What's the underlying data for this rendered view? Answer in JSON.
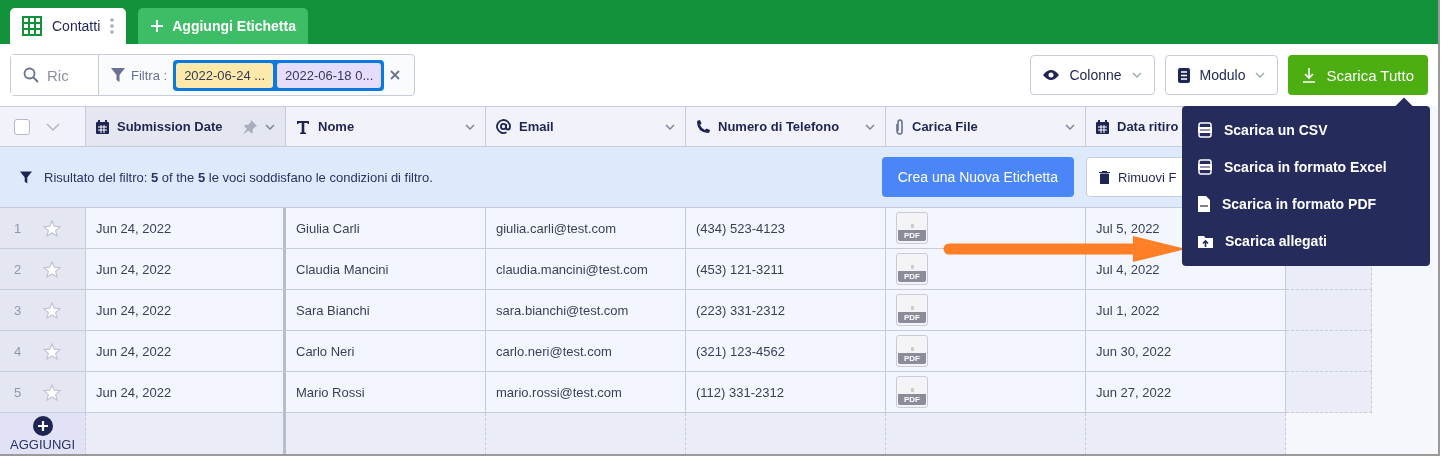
{
  "tabs": [
    {
      "label": "Contatti",
      "selected": true
    }
  ],
  "add_tab_button": "Aggiungi Etichetta",
  "toolbar": {
    "search": {
      "placeholder": "Ric"
    },
    "filter_label": "Filtra :",
    "filter_chips": [
      {
        "label": "2022-06-24 ...",
        "color": "#fde9a9"
      },
      {
        "label": "2022-06-18 0...",
        "color": "#e5ddfb"
      }
    ],
    "columns_button": "Colonne",
    "form_button": "Modulo",
    "download_button": "Scarica Tutto"
  },
  "table": {
    "select_all": {
      "checked": false
    },
    "columns": [
      {
        "label": "Submission Date",
        "kind": "calendar",
        "pinned": true
      },
      {
        "label": "Nome",
        "kind": "text",
        "pinned": false
      },
      {
        "label": "Email",
        "kind": "at",
        "pinned": false
      },
      {
        "label": "Numero di Telefono",
        "kind": "phone",
        "pinned": false
      },
      {
        "label": "Carica File",
        "kind": "clip",
        "pinned": false
      },
      {
        "label": "Data ritiro",
        "kind": "calendar",
        "pinned": false
      }
    ],
    "filter_banner": {
      "text": "Risultato del filtro: **5** of the **5** le voci soddisfano le condizioni di filtro.",
      "create_button": "Crea una Nuova Etichetta",
      "remove_button": "Rimuovi F"
    },
    "rows": [
      {
        "number": "1",
        "starred": false,
        "date": "Jun 24, 2022",
        "name": "Giulia Carli",
        "email": "giulia.carli@test.com",
        "phone": "(434) 523-4123",
        "file": "PDF",
        "pickup": "Jul 5, 2022"
      },
      {
        "number": "2",
        "starred": false,
        "date": "Jun 24, 2022",
        "name": "Claudia Mancini",
        "email": "claudia.mancini@test.com",
        "phone": "(453) 121-3211",
        "file": "PDF",
        "pickup": "Jul 4, 2022"
      },
      {
        "number": "3",
        "starred": false,
        "date": "Jun 24, 2022",
        "name": "Sara Bianchi",
        "email": "sara.bianchi@test.com",
        "phone": "(223) 331-2312",
        "file": "PDF",
        "pickup": "Jul 1, 2022"
      },
      {
        "number": "4",
        "starred": false,
        "date": "Jun 24, 2022",
        "name": "Carlo Neri",
        "email": "carlo.neri@test.com",
        "phone": "(321) 123-4562",
        "file": "PDF",
        "pickup": "Jun 30, 2022"
      },
      {
        "number": "5",
        "starred": false,
        "date": "Jun 24, 2022",
        "name": "Mario Rossi",
        "email": "mario.rossi@test.com",
        "phone": "(112) 331-2312",
        "file": "PDF",
        "pickup": "Jun 27, 2022"
      }
    ],
    "add_row": "AGGIUNGI"
  },
  "download_menu": {
    "items": [
      {
        "label": "Scarica un CSV",
        "kind": "csv"
      },
      {
        "label": "Scarica in formato Excel",
        "kind": "excel"
      },
      {
        "label": "Scarica in formato PDF",
        "kind": "pdf"
      },
      {
        "label": "Scarica allegati",
        "kind": "folder"
      }
    ]
  }
}
